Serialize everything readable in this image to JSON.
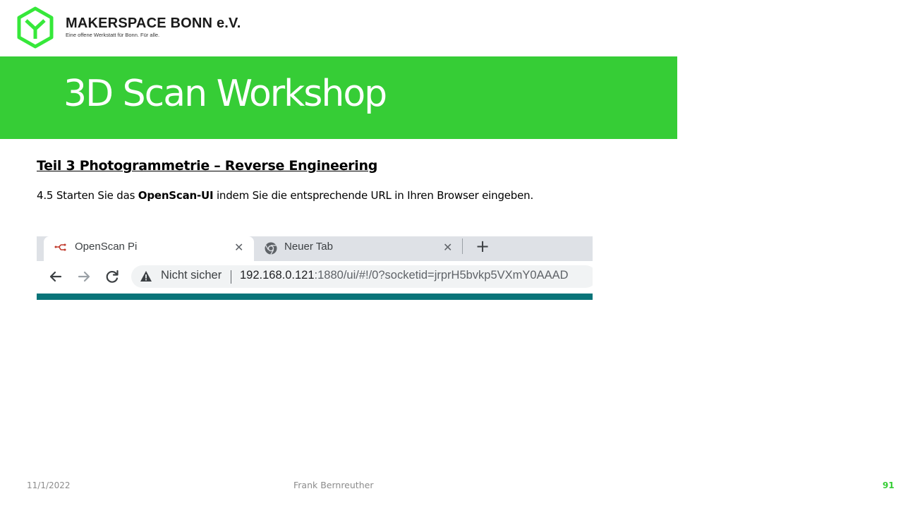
{
  "header": {
    "logo_icon": "makerspace-hexagon-logo",
    "brand_name": "MAKERSPACE BONN e.V.",
    "brand_tagline": "Eine offene Werkstatt für Bonn. Für alle.",
    "brand_color": "#36cd36"
  },
  "slide": {
    "title": "3D Scan Workshop",
    "section_heading": "Teil 3  Photogrammetrie  – Reverse Engineering",
    "instruction": {
      "prefix": "4.5 Starten Sie das ",
      "bold": "OpenScan-UI",
      "suffix": " indem Sie die  entsprechende URL in Ihren Browser eingeben."
    }
  },
  "browser": {
    "tabs": [
      {
        "label": "OpenScan Pi",
        "icon": "node-red-icon",
        "active": true
      },
      {
        "label": "Neuer Tab",
        "icon": "chrome-icon",
        "active": false
      }
    ],
    "new_tab_icon": "plus-icon",
    "close_icon": "close-icon",
    "nav": {
      "back": "back-arrow-icon",
      "forward": "forward-arrow-icon",
      "reload": "reload-icon"
    },
    "security_label": "Nicht sicher",
    "url_host": "192.168.0.121",
    "url_rest": ":1880/ui/#!/0?socketid=jrprH5bvkp5VXmY0AAAD",
    "page_strip_color": "#097479"
  },
  "footer": {
    "date": "11/1/2022",
    "author": "Frank Bernreuther",
    "page_number": "91"
  }
}
